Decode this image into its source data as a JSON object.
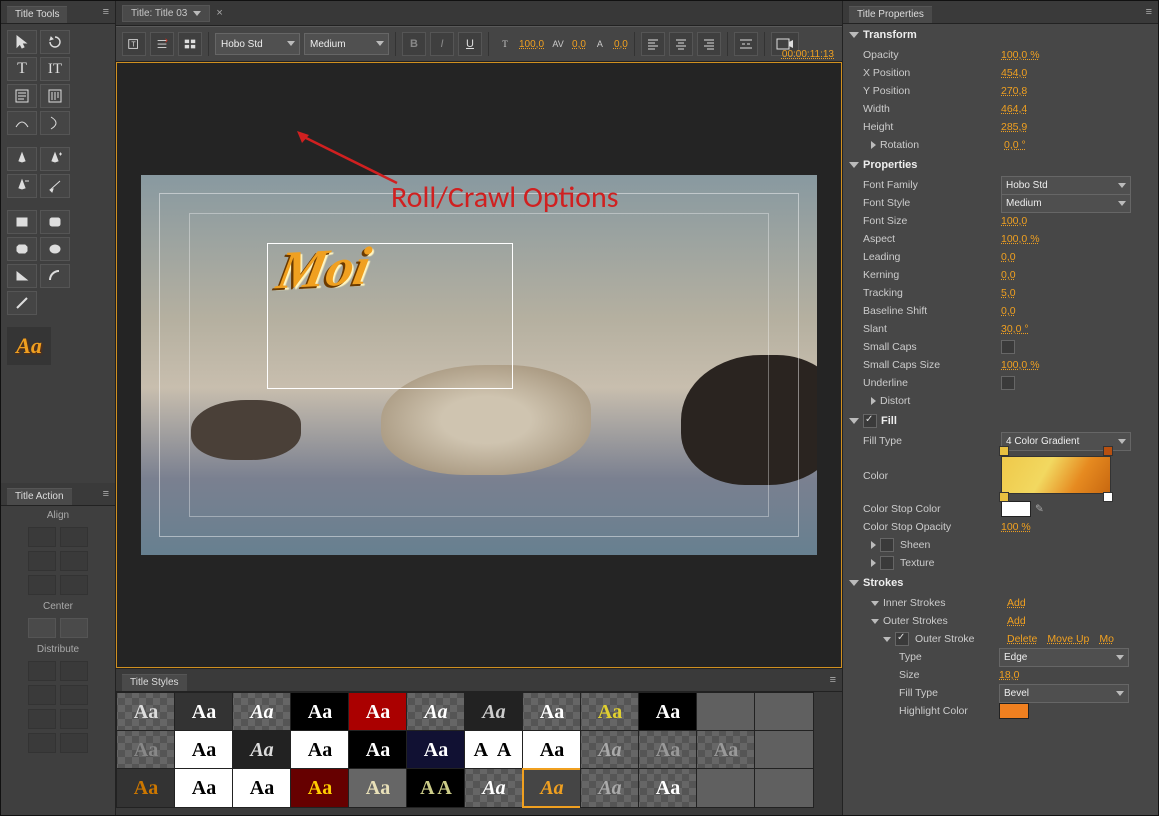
{
  "window": {
    "close": "×"
  },
  "panels": {
    "tools": "Title Tools",
    "actions": "Title Action",
    "styles": "Title Styles",
    "properties": "Title Properties"
  },
  "doc_tab": {
    "label": "Title: Title 03"
  },
  "toolbar": {
    "font_family": "Hobo Std",
    "font_style": "Medium",
    "bold": "B",
    "italic": "I",
    "underline": "U",
    "size_icon": "T",
    "size_val": "100,0",
    "kern_icon": "AV",
    "kern_val": "0,0",
    "lead_icon": "A",
    "lead_val": "0,0",
    "timecode": "00:00:11:13"
  },
  "annotation": "Roll/Crawl Options",
  "canvas": {
    "title_text": "Moi"
  },
  "actions": {
    "align": "Align",
    "center": "Center",
    "distribute": "Distribute"
  },
  "props": {
    "transform": "Transform",
    "opacity_l": "Opacity",
    "opacity_v": "100,0 %",
    "xpos_l": "X Position",
    "xpos_v": "454,0",
    "ypos_l": "Y Position",
    "ypos_v": "270,8",
    "width_l": "Width",
    "width_v": "464,4",
    "height_l": "Height",
    "height_v": "285,9",
    "rotation_l": "Rotation",
    "rotation_v": "0,0 °",
    "properties": "Properties",
    "fontfam_l": "Font Family",
    "fontfam_v": "Hobo Std",
    "fontsty_l": "Font Style",
    "fontsty_v": "Medium",
    "fontsize_l": "Font Size",
    "fontsize_v": "100,0",
    "aspect_l": "Aspect",
    "aspect_v": "100,0 %",
    "leading_l": "Leading",
    "leading_v": "0,0",
    "kerning_l": "Kerning",
    "kerning_v": "0,0",
    "tracking_l": "Tracking",
    "tracking_v": "5,0",
    "baseline_l": "Baseline Shift",
    "baseline_v": "0,0",
    "slant_l": "Slant",
    "slant_v": "30,0 °",
    "smallcaps_l": "Small Caps",
    "smallcapssize_l": "Small Caps Size",
    "smallcapssize_v": "100,0 %",
    "underline_l": "Underline",
    "distort_l": "Distort",
    "fill": "Fill",
    "filltype_l": "Fill Type",
    "filltype_v": "4 Color Gradient",
    "color_l": "Color",
    "colorstop_l": "Color Stop Color",
    "colorstopop_l": "Color Stop Opacity",
    "colorstopop_v": "100 %",
    "sheen_l": "Sheen",
    "texture_l": "Texture",
    "strokes": "Strokes",
    "inner_l": "Inner Strokes",
    "outer_l": "Outer Strokes",
    "add": "Add",
    "delete": "Delete",
    "moveup": "Move Up",
    "movedown": "Mo",
    "outerstroke_l": "Outer Stroke",
    "os_type_l": "Type",
    "os_type_v": "Edge",
    "os_size_l": "Size",
    "os_size_v": "18,0",
    "os_fill_l": "Fill Type",
    "os_fill_v": "Bevel",
    "os_hl_l": "Highlight Color"
  }
}
